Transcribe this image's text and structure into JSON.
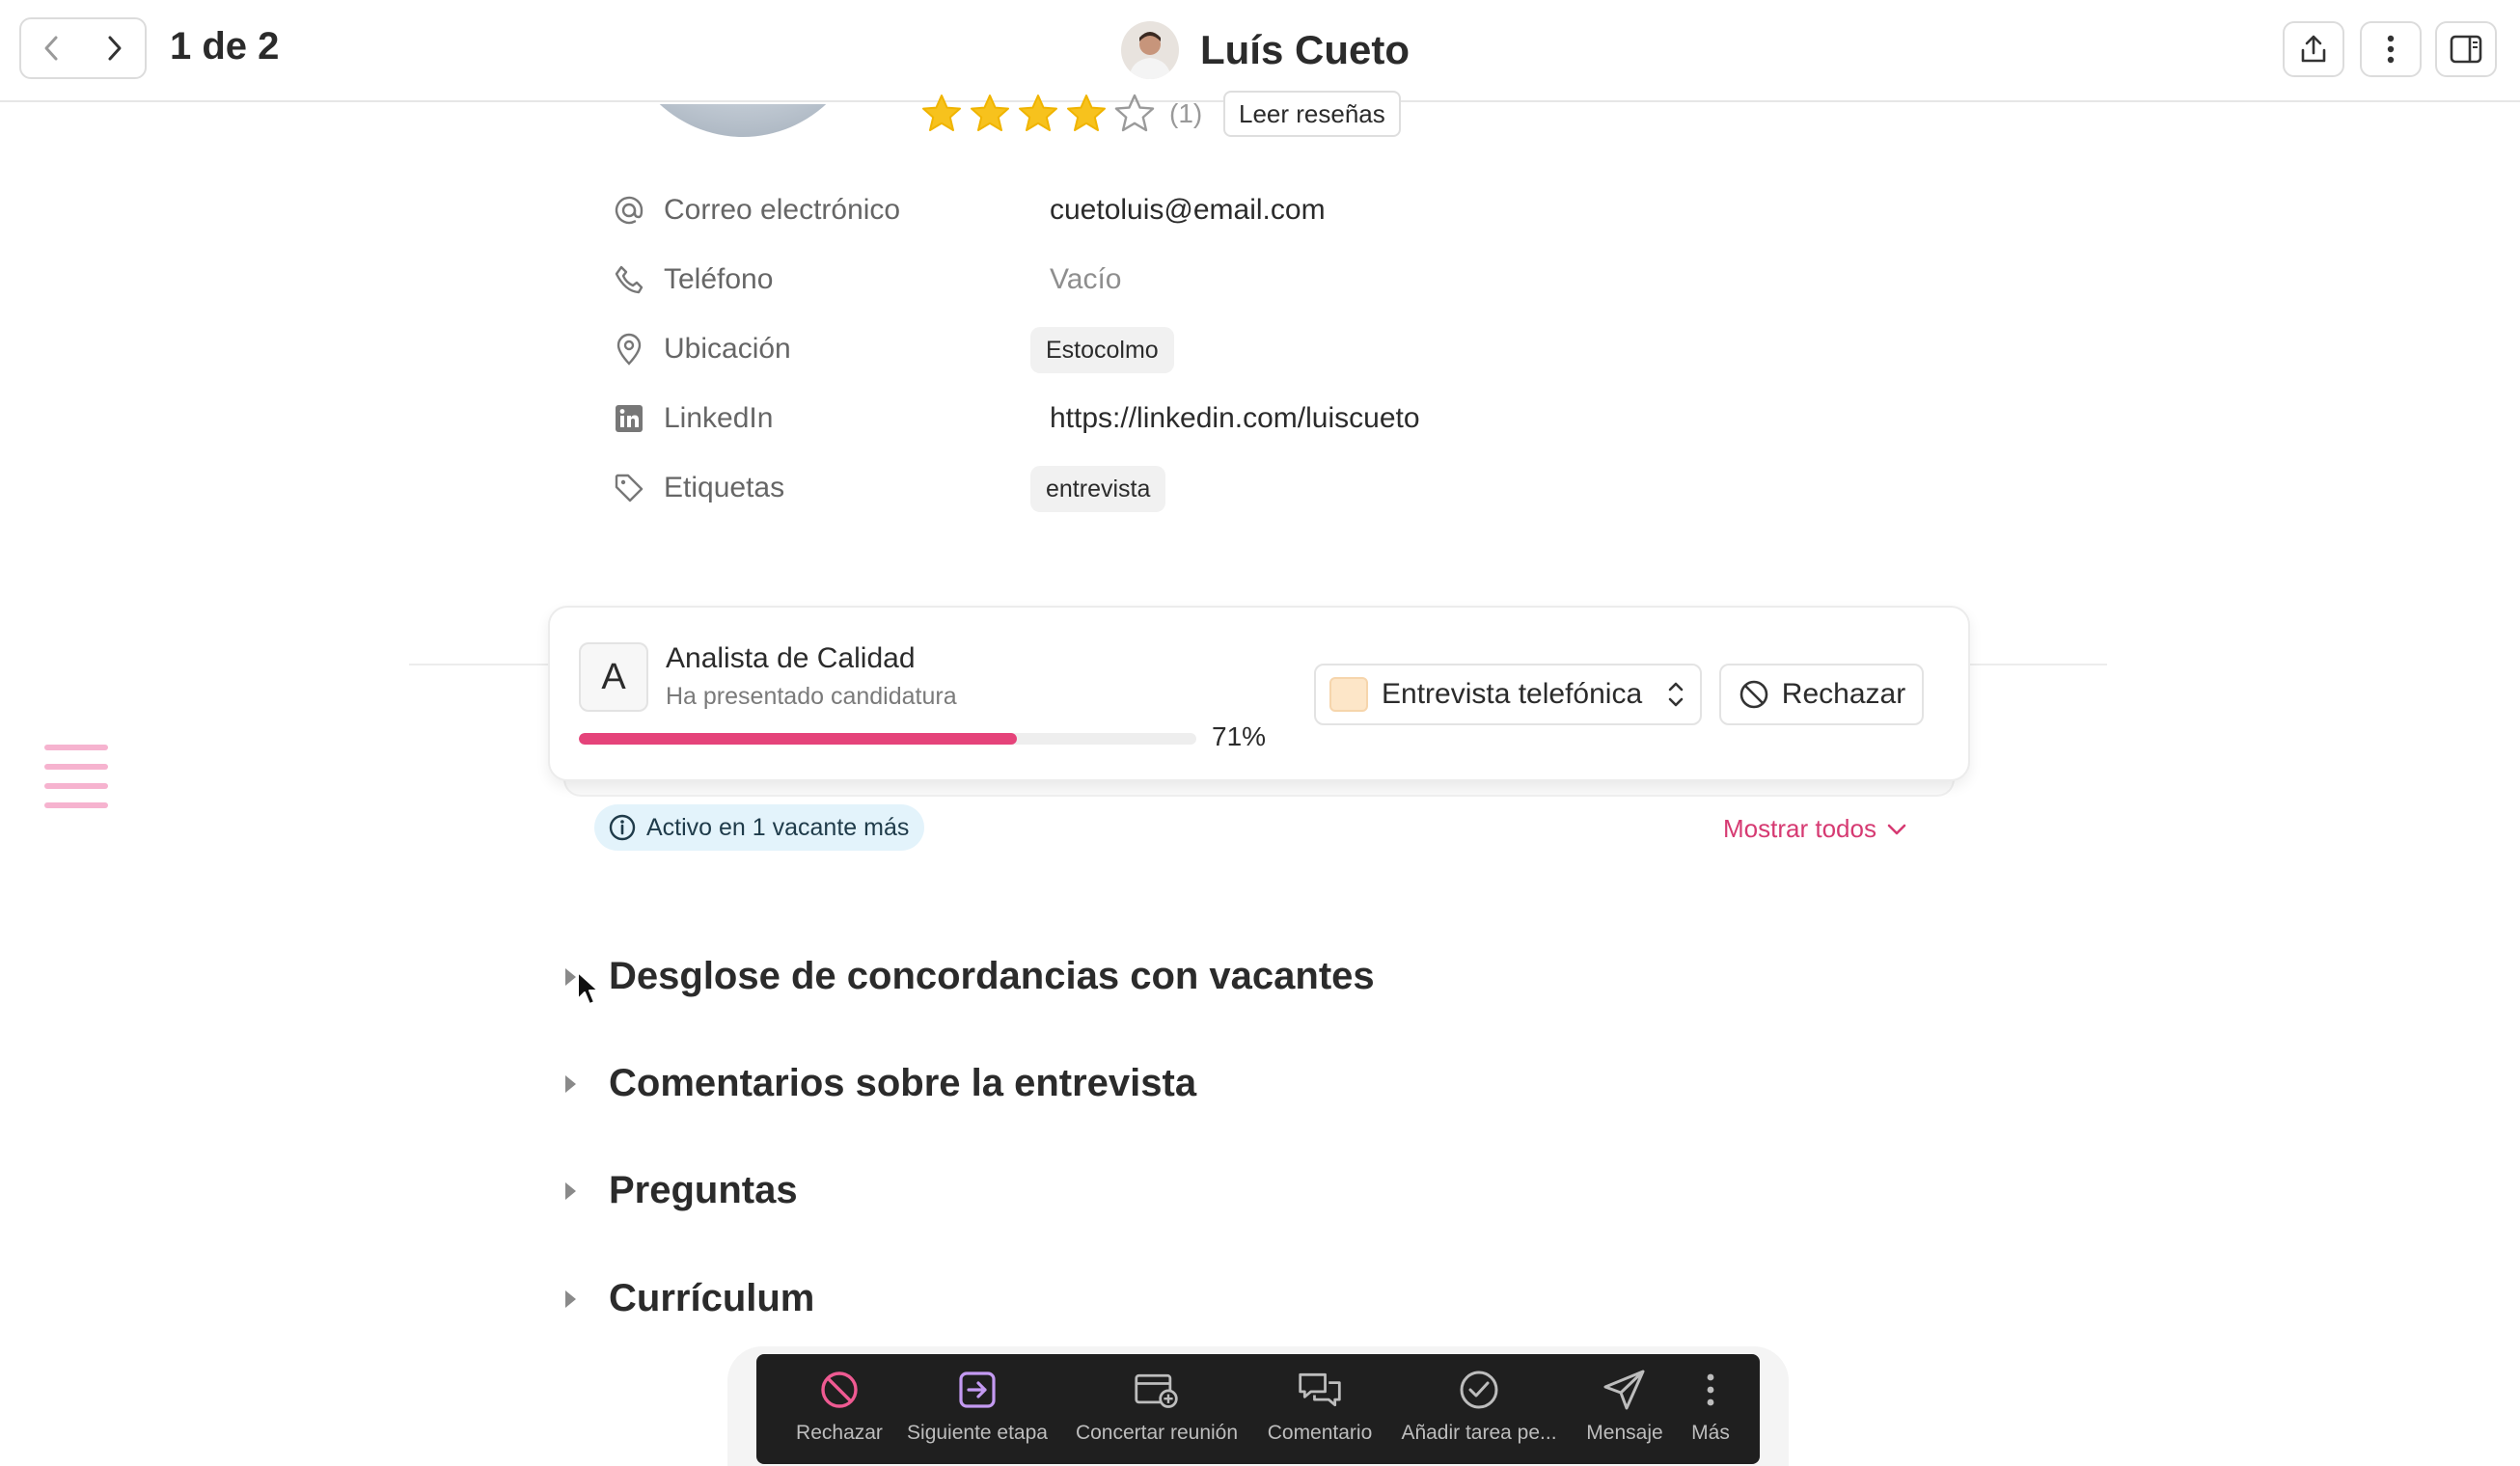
{
  "topbar": {
    "pager": "1 de 2",
    "candidate_name": "Luís Cueto",
    "icons": [
      "chevron-left-icon",
      "chevron-right-icon",
      "share-icon",
      "more-vertical-icon",
      "sidebar-panel-icon"
    ]
  },
  "profile": {
    "rating": 4,
    "rating_max": 5,
    "review_count": "(1)",
    "read_reviews_label": "Leer reseñas"
  },
  "details": [
    {
      "icon": "at-icon",
      "label": "Correo electrónico",
      "value": "cuetoluis@email.com",
      "type": "text"
    },
    {
      "icon": "phone-icon",
      "label": "Teléfono",
      "value": "Vacío",
      "type": "muted"
    },
    {
      "icon": "location-pin-icon",
      "label": "Ubicación",
      "value": "Estocolmo",
      "type": "chip"
    },
    {
      "icon": "linkedin-icon",
      "label": "LinkedIn",
      "value": "https://linkedin.com/luiscueto",
      "type": "text"
    },
    {
      "icon": "tag-icon",
      "label": "Etiquetas",
      "value": "entrevista",
      "type": "chip"
    }
  ],
  "job": {
    "letter": "A",
    "title": "Analista de Calidad",
    "status": "Ha presentado candidatura",
    "match_percent": 71,
    "match_label": "71%",
    "stage": "Entrevista telefónica",
    "reject_label": "Rechazar",
    "colors": {
      "progress": "#e5437a",
      "stage_swatch": "#fde6c8"
    }
  },
  "active_badge": "Activo en 1 vacante más",
  "show_all": "Mostrar todos",
  "sections": [
    "Desglose de concordancias con vacantes",
    "Comentarios sobre la entrevista",
    "Preguntas",
    "Currículum"
  ],
  "action_bar": [
    {
      "icon": "reject-icon",
      "label": "Rechazar"
    },
    {
      "icon": "next-stage-icon",
      "label": "Siguiente etapa"
    },
    {
      "icon": "calendar-plus-icon",
      "label": "Concertar reunión"
    },
    {
      "icon": "comment-icon",
      "label": "Comentario"
    },
    {
      "icon": "check-circle-icon",
      "label": "Añadir tarea pe..."
    },
    {
      "icon": "send-icon",
      "label": "Mensaje"
    },
    {
      "icon": "more-vertical-icon",
      "label": "Más"
    }
  ],
  "colors": {
    "accent": "#d63a72",
    "brand_pink": "#e5437a",
    "badge_bg": "#e3f3fb",
    "action_bar_bg": "#1f1f1f"
  }
}
